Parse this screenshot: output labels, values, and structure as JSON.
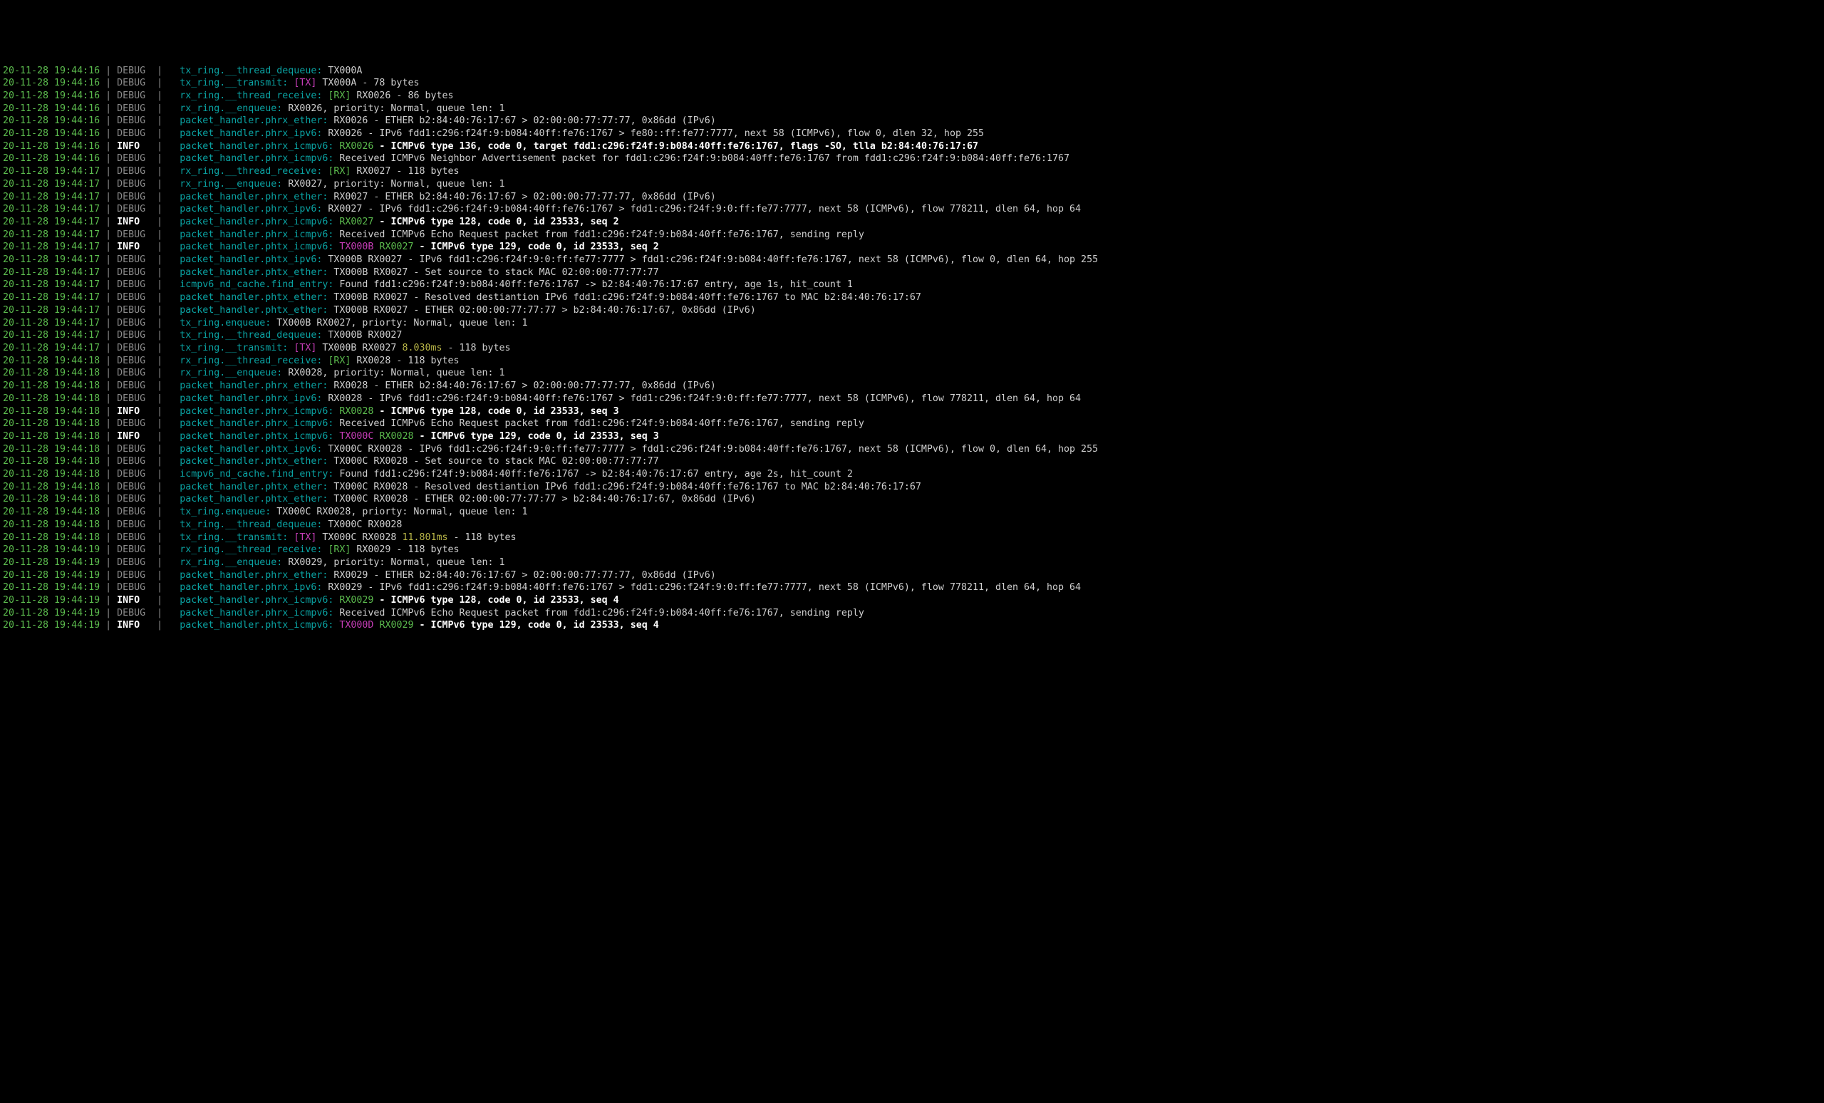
{
  "lines": [
    {
      "ts": "20-11-28 19:44:16",
      "lvl": "DEBUG",
      "tag": "tx_ring.__thread_dequeue:",
      "segs": [
        {
          "t": " TX000A",
          "c": "plain"
        }
      ]
    },
    {
      "ts": "20-11-28 19:44:16",
      "lvl": "DEBUG",
      "tag": "tx_ring.__transmit:",
      "segs": [
        {
          "t": " ",
          "c": "plain"
        },
        {
          "t": "[TX]",
          "c": "tx"
        },
        {
          "t": " TX000A - 78 bytes",
          "c": "plain"
        }
      ]
    },
    {
      "ts": "20-11-28 19:44:16",
      "lvl": "DEBUG",
      "tag": "rx_ring.__thread_receive:",
      "segs": [
        {
          "t": " ",
          "c": "plain"
        },
        {
          "t": "[RX]",
          "c": "rx"
        },
        {
          "t": " RX0026 - 86 bytes",
          "c": "plain"
        }
      ]
    },
    {
      "ts": "20-11-28 19:44:16",
      "lvl": "DEBUG",
      "tag": "rx_ring.__enqueue:",
      "segs": [
        {
          "t": " RX0026, priority: Normal, queue len: 1",
          "c": "plain"
        }
      ]
    },
    {
      "ts": "20-11-28 19:44:16",
      "lvl": "DEBUG",
      "tag": "packet_handler.phrx_ether:",
      "segs": [
        {
          "t": " RX0026 - ETHER b2:84:40:76:17:67 > 02:00:00:77:77:77, 0x86dd (IPv6)",
          "c": "plain"
        }
      ]
    },
    {
      "ts": "20-11-28 19:44:16",
      "lvl": "DEBUG",
      "tag": "packet_handler.phrx_ipv6:",
      "segs": [
        {
          "t": " RX0026 - IPv6 fdd1:c296:f24f:9:b084:40ff:fe76:1767 > fe80::ff:fe77:7777, next 58 (ICMPv6), flow 0, dlen 32, hop 255",
          "c": "plain"
        }
      ]
    },
    {
      "ts": "20-11-28 19:44:16",
      "lvl": "INFO",
      "tag": "packet_handler.phrx_icmpv6:",
      "segs": [
        {
          "t": " ",
          "c": "plain"
        },
        {
          "t": "RX0026",
          "c": "rxid"
        },
        {
          "t": " - ICMPv6 type 136, code 0, target fdd1:c296:f24f:9:b084:40ff:fe76:1767, flags -SO, tlla b2:84:40:76:17:67",
          "c": "bold"
        }
      ]
    },
    {
      "ts": "20-11-28 19:44:16",
      "lvl": "DEBUG",
      "tag": "packet_handler.phrx_icmpv6:",
      "segs": [
        {
          "t": " Received ICMPv6 Neighbor Advertisement packet for fdd1:c296:f24f:9:b084:40ff:fe76:1767 from fdd1:c296:f24f:9:b084:40ff:fe76:1767",
          "c": "plain"
        }
      ]
    },
    {
      "ts": "20-11-28 19:44:17",
      "lvl": "DEBUG",
      "tag": "rx_ring.__thread_receive:",
      "segs": [
        {
          "t": " ",
          "c": "plain"
        },
        {
          "t": "[RX]",
          "c": "rx"
        },
        {
          "t": " RX0027 - 118 bytes",
          "c": "plain"
        }
      ]
    },
    {
      "ts": "20-11-28 19:44:17",
      "lvl": "DEBUG",
      "tag": "rx_ring.__enqueue:",
      "segs": [
        {
          "t": " RX0027, priority: Normal, queue len: 1",
          "c": "plain"
        }
      ]
    },
    {
      "ts": "20-11-28 19:44:17",
      "lvl": "DEBUG",
      "tag": "packet_handler.phrx_ether:",
      "segs": [
        {
          "t": " RX0027 - ETHER b2:84:40:76:17:67 > 02:00:00:77:77:77, 0x86dd (IPv6)",
          "c": "plain"
        }
      ]
    },
    {
      "ts": "20-11-28 19:44:17",
      "lvl": "DEBUG",
      "tag": "packet_handler.phrx_ipv6:",
      "segs": [
        {
          "t": " RX0027 - IPv6 fdd1:c296:f24f:9:b084:40ff:fe76:1767 > fdd1:c296:f24f:9:0:ff:fe77:7777, next 58 (ICMPv6), flow 778211, dlen 64, hop 64",
          "c": "plain"
        }
      ]
    },
    {
      "ts": "20-11-28 19:44:17",
      "lvl": "INFO",
      "tag": "packet_handler.phrx_icmpv6:",
      "segs": [
        {
          "t": " ",
          "c": "plain"
        },
        {
          "t": "RX0027",
          "c": "rxid"
        },
        {
          "t": " - ICMPv6 type 128, code 0, id 23533, seq 2",
          "c": "bold"
        }
      ]
    },
    {
      "ts": "20-11-28 19:44:17",
      "lvl": "DEBUG",
      "tag": "packet_handler.phrx_icmpv6:",
      "segs": [
        {
          "t": " Received ICMPv6 Echo Request packet from fdd1:c296:f24f:9:b084:40ff:fe76:1767, sending reply",
          "c": "plain"
        }
      ]
    },
    {
      "ts": "20-11-28 19:44:17",
      "lvl": "INFO",
      "tag": "packet_handler.phtx_icmpv6:",
      "segs": [
        {
          "t": " ",
          "c": "plain"
        },
        {
          "t": "TX000B",
          "c": "txid"
        },
        {
          "t": " ",
          "c": "plain"
        },
        {
          "t": "RX0027",
          "c": "rxid"
        },
        {
          "t": " - ICMPv6 type 129, code 0, id 23533, seq 2",
          "c": "bold"
        }
      ]
    },
    {
      "ts": "20-11-28 19:44:17",
      "lvl": "DEBUG",
      "tag": "packet_handler.phtx_ipv6:",
      "segs": [
        {
          "t": " TX000B RX0027 - IPv6 fdd1:c296:f24f:9:0:ff:fe77:7777 > fdd1:c296:f24f:9:b084:40ff:fe76:1767, next 58 (ICMPv6), flow 0, dlen 64, hop 255",
          "c": "plain"
        }
      ]
    },
    {
      "ts": "20-11-28 19:44:17",
      "lvl": "DEBUG",
      "tag": "packet_handler.phtx_ether:",
      "segs": [
        {
          "t": " TX000B RX0027 - Set source to stack MAC 02:00:00:77:77:77",
          "c": "plain"
        }
      ]
    },
    {
      "ts": "20-11-28 19:44:17",
      "lvl": "DEBUG",
      "tag": "icmpv6_nd_cache.find_entry:",
      "segs": [
        {
          "t": " Found fdd1:c296:f24f:9:b084:40ff:fe76:1767 -> b2:84:40:76:17:67 entry, age 1s, hit_count 1",
          "c": "plain"
        }
      ]
    },
    {
      "ts": "20-11-28 19:44:17",
      "lvl": "DEBUG",
      "tag": "packet_handler.phtx_ether:",
      "segs": [
        {
          "t": " TX000B RX0027 - Resolved destiantion IPv6 fdd1:c296:f24f:9:b084:40ff:fe76:1767 to MAC b2:84:40:76:17:67",
          "c": "plain"
        }
      ]
    },
    {
      "ts": "20-11-28 19:44:17",
      "lvl": "DEBUG",
      "tag": "packet_handler.phtx_ether:",
      "segs": [
        {
          "t": " TX000B RX0027 - ETHER 02:00:00:77:77:77 > b2:84:40:76:17:67, 0x86dd (IPv6)",
          "c": "plain"
        }
      ]
    },
    {
      "ts": "20-11-28 19:44:17",
      "lvl": "DEBUG",
      "tag": "tx_ring.enqueue:",
      "segs": [
        {
          "t": " TX000B RX0027, priorty: Normal, queue len: 1",
          "c": "plain"
        }
      ]
    },
    {
      "ts": "20-11-28 19:44:17",
      "lvl": "DEBUG",
      "tag": "tx_ring.__thread_dequeue:",
      "segs": [
        {
          "t": " TX000B RX0027",
          "c": "plain"
        }
      ]
    },
    {
      "ts": "20-11-28 19:44:17",
      "lvl": "DEBUG",
      "tag": "tx_ring.__transmit:",
      "segs": [
        {
          "t": " ",
          "c": "plain"
        },
        {
          "t": "[TX]",
          "c": "tx"
        },
        {
          "t": " TX000B RX0027 ",
          "c": "plain"
        },
        {
          "t": "8.030ms",
          "c": "ms"
        },
        {
          "t": " - 118 bytes",
          "c": "plain"
        }
      ]
    },
    {
      "ts": "20-11-28 19:44:18",
      "lvl": "DEBUG",
      "tag": "rx_ring.__thread_receive:",
      "segs": [
        {
          "t": " ",
          "c": "plain"
        },
        {
          "t": "[RX]",
          "c": "rx"
        },
        {
          "t": " RX0028 - 118 bytes",
          "c": "plain"
        }
      ]
    },
    {
      "ts": "20-11-28 19:44:18",
      "lvl": "DEBUG",
      "tag": "rx_ring.__enqueue:",
      "segs": [
        {
          "t": " RX0028, priority: Normal, queue len: 1",
          "c": "plain"
        }
      ]
    },
    {
      "ts": "20-11-28 19:44:18",
      "lvl": "DEBUG",
      "tag": "packet_handler.phrx_ether:",
      "segs": [
        {
          "t": " RX0028 - ETHER b2:84:40:76:17:67 > 02:00:00:77:77:77, 0x86dd (IPv6)",
          "c": "plain"
        }
      ]
    },
    {
      "ts": "20-11-28 19:44:18",
      "lvl": "DEBUG",
      "tag": "packet_handler.phrx_ipv6:",
      "segs": [
        {
          "t": " RX0028 - IPv6 fdd1:c296:f24f:9:b084:40ff:fe76:1767 > fdd1:c296:f24f:9:0:ff:fe77:7777, next 58 (ICMPv6), flow 778211, dlen 64, hop 64",
          "c": "plain"
        }
      ]
    },
    {
      "ts": "20-11-28 19:44:18",
      "lvl": "INFO",
      "tag": "packet_handler.phrx_icmpv6:",
      "segs": [
        {
          "t": " ",
          "c": "plain"
        },
        {
          "t": "RX0028",
          "c": "rxid"
        },
        {
          "t": " - ICMPv6 type 128, code 0, id 23533, seq 3",
          "c": "bold"
        }
      ]
    },
    {
      "ts": "20-11-28 19:44:18",
      "lvl": "DEBUG",
      "tag": "packet_handler.phrx_icmpv6:",
      "segs": [
        {
          "t": " Received ICMPv6 Echo Request packet from fdd1:c296:f24f:9:b084:40ff:fe76:1767, sending reply",
          "c": "plain"
        }
      ]
    },
    {
      "ts": "20-11-28 19:44:18",
      "lvl": "INFO",
      "tag": "packet_handler.phtx_icmpv6:",
      "segs": [
        {
          "t": " ",
          "c": "plain"
        },
        {
          "t": "TX000C",
          "c": "txid"
        },
        {
          "t": " ",
          "c": "plain"
        },
        {
          "t": "RX0028",
          "c": "rxid"
        },
        {
          "t": " - ICMPv6 type 129, code 0, id 23533, seq 3",
          "c": "bold"
        }
      ]
    },
    {
      "ts": "20-11-28 19:44:18",
      "lvl": "DEBUG",
      "tag": "packet_handler.phtx_ipv6:",
      "segs": [
        {
          "t": " TX000C RX0028 - IPv6 fdd1:c296:f24f:9:0:ff:fe77:7777 > fdd1:c296:f24f:9:b084:40ff:fe76:1767, next 58 (ICMPv6), flow 0, dlen 64, hop 255",
          "c": "plain"
        }
      ]
    },
    {
      "ts": "20-11-28 19:44:18",
      "lvl": "DEBUG",
      "tag": "packet_handler.phtx_ether:",
      "segs": [
        {
          "t": " TX000C RX0028 - Set source to stack MAC 02:00:00:77:77:77",
          "c": "plain"
        }
      ]
    },
    {
      "ts": "20-11-28 19:44:18",
      "lvl": "DEBUG",
      "tag": "icmpv6_nd_cache.find_entry:",
      "segs": [
        {
          "t": " Found fdd1:c296:f24f:9:b084:40ff:fe76:1767 -> b2:84:40:76:17:67 entry, age 2s, hit_count 2",
          "c": "plain"
        }
      ]
    },
    {
      "ts": "20-11-28 19:44:18",
      "lvl": "DEBUG",
      "tag": "packet_handler.phtx_ether:",
      "segs": [
        {
          "t": " TX000C RX0028 - Resolved destiantion IPv6 fdd1:c296:f24f:9:b084:40ff:fe76:1767 to MAC b2:84:40:76:17:67",
          "c": "plain"
        }
      ]
    },
    {
      "ts": "20-11-28 19:44:18",
      "lvl": "DEBUG",
      "tag": "packet_handler.phtx_ether:",
      "segs": [
        {
          "t": " TX000C RX0028 - ETHER 02:00:00:77:77:77 > b2:84:40:76:17:67, 0x86dd (IPv6)",
          "c": "plain"
        }
      ]
    },
    {
      "ts": "20-11-28 19:44:18",
      "lvl": "DEBUG",
      "tag": "tx_ring.enqueue:",
      "segs": [
        {
          "t": " TX000C RX0028, priorty: Normal, queue len: 1",
          "c": "plain"
        }
      ]
    },
    {
      "ts": "20-11-28 19:44:18",
      "lvl": "DEBUG",
      "tag": "tx_ring.__thread_dequeue:",
      "segs": [
        {
          "t": " TX000C RX0028",
          "c": "plain"
        }
      ]
    },
    {
      "ts": "20-11-28 19:44:18",
      "lvl": "DEBUG",
      "tag": "tx_ring.__transmit:",
      "segs": [
        {
          "t": " ",
          "c": "plain"
        },
        {
          "t": "[TX]",
          "c": "tx"
        },
        {
          "t": " TX000C RX0028 ",
          "c": "plain"
        },
        {
          "t": "11.801ms",
          "c": "ms"
        },
        {
          "t": " - 118 bytes",
          "c": "plain"
        }
      ]
    },
    {
      "ts": "20-11-28 19:44:19",
      "lvl": "DEBUG",
      "tag": "rx_ring.__thread_receive:",
      "segs": [
        {
          "t": " ",
          "c": "plain"
        },
        {
          "t": "[RX]",
          "c": "rx"
        },
        {
          "t": " RX0029 - 118 bytes",
          "c": "plain"
        }
      ]
    },
    {
      "ts": "20-11-28 19:44:19",
      "lvl": "DEBUG",
      "tag": "rx_ring.__enqueue:",
      "segs": [
        {
          "t": " RX0029, priority: Normal, queue len: 1",
          "c": "plain"
        }
      ]
    },
    {
      "ts": "20-11-28 19:44:19",
      "lvl": "DEBUG",
      "tag": "packet_handler.phrx_ether:",
      "segs": [
        {
          "t": " RX0029 - ETHER b2:84:40:76:17:67 > 02:00:00:77:77:77, 0x86dd (IPv6)",
          "c": "plain"
        }
      ]
    },
    {
      "ts": "20-11-28 19:44:19",
      "lvl": "DEBUG",
      "tag": "packet_handler.phrx_ipv6:",
      "segs": [
        {
          "t": " RX0029 - IPv6 fdd1:c296:f24f:9:b084:40ff:fe76:1767 > fdd1:c296:f24f:9:0:ff:fe77:7777, next 58 (ICMPv6), flow 778211, dlen 64, hop 64",
          "c": "plain"
        }
      ]
    },
    {
      "ts": "20-11-28 19:44:19",
      "lvl": "INFO",
      "tag": "packet_handler.phrx_icmpv6:",
      "segs": [
        {
          "t": " ",
          "c": "plain"
        },
        {
          "t": "RX0029",
          "c": "rxid"
        },
        {
          "t": " - ICMPv6 type 128, code 0, id 23533, seq 4",
          "c": "bold"
        }
      ]
    },
    {
      "ts": "20-11-28 19:44:19",
      "lvl": "DEBUG",
      "tag": "packet_handler.phrx_icmpv6:",
      "segs": [
        {
          "t": " Received ICMPv6 Echo Request packet from fdd1:c296:f24f:9:b084:40ff:fe76:1767, sending reply",
          "c": "plain"
        }
      ]
    },
    {
      "ts": "20-11-28 19:44:19",
      "lvl": "INFO",
      "tag": "packet_handler.phtx_icmpv6:",
      "segs": [
        {
          "t": " ",
          "c": "plain"
        },
        {
          "t": "TX000D",
          "c": "txid"
        },
        {
          "t": " ",
          "c": "plain"
        },
        {
          "t": "RX0029",
          "c": "rxid"
        },
        {
          "t": " - ICMPv6 type 129, code 0, id 23533, seq 4",
          "c": "bold"
        }
      ]
    }
  ]
}
